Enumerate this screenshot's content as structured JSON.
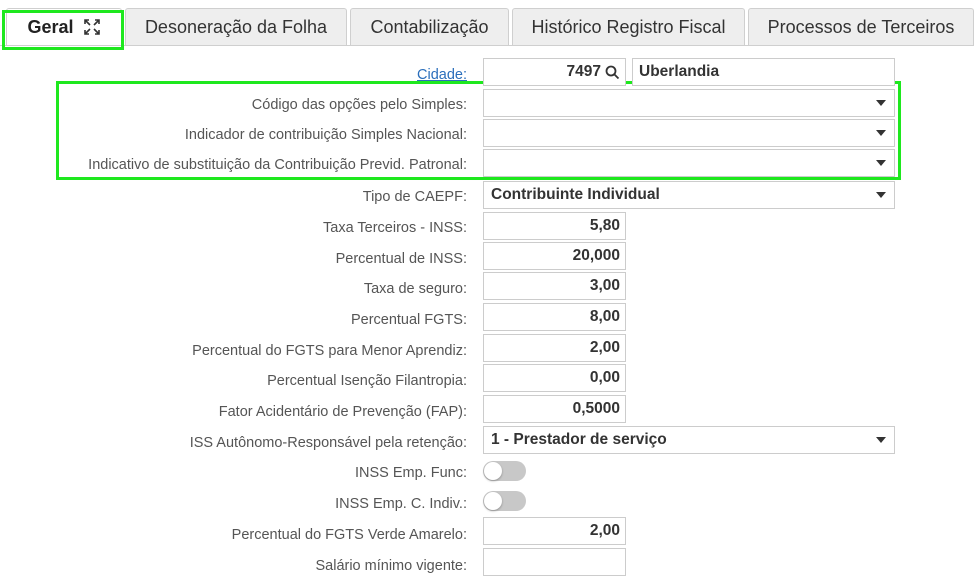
{
  "tabs": [
    {
      "label": "Geral",
      "active": true,
      "icon": "expand-icon"
    },
    {
      "label": "Desoneração da Folha"
    },
    {
      "label": "Contabilização"
    },
    {
      "label": "Histórico Registro Fiscal"
    },
    {
      "label": "Processos de Terceiros"
    }
  ],
  "colors": {
    "highlight": "#1ee81e",
    "link": "#2a6ebb"
  },
  "form": {
    "cidade": {
      "label": "Cidade:",
      "code": "7497",
      "icon": "search-icon",
      "name": "Uberlandia"
    },
    "codigo_opcoes_simples": {
      "label": "Código das opções pelo Simples:",
      "value": ""
    },
    "indicador_simples": {
      "label": "Indicador de contribuição Simples Nacional:",
      "value": ""
    },
    "indicativo_substituicao": {
      "label": "Indicativo de substituição da Contribuição Previd. Patronal:",
      "value": ""
    },
    "tipo_caepf": {
      "label": "Tipo de CAEPF:",
      "value": "Contribuinte Individual"
    },
    "taxa_terceiros": {
      "label": "Taxa Terceiros - INSS:",
      "value": "5,80"
    },
    "percentual_inss": {
      "label": "Percentual de INSS:",
      "value": "20,000"
    },
    "taxa_seguro": {
      "label": "Taxa de seguro:",
      "value": "3,00"
    },
    "percentual_fgts": {
      "label": "Percentual FGTS:",
      "value": "8,00"
    },
    "fgts_menor_aprendiz": {
      "label": "Percentual do FGTS para Menor Aprendiz:",
      "value": "2,00"
    },
    "isencao_filantropia": {
      "label": "Percentual Isenção Filantropia:",
      "value": "0,00"
    },
    "fap": {
      "label": "Fator Acidentário de Prevenção (FAP):",
      "value": "0,5000"
    },
    "iss_autonomo": {
      "label": "ISS Autônomo-Responsável pela retenção:",
      "value": "1 - Prestador de serviço"
    },
    "inss_emp_func": {
      "label": "INSS Emp. Func:",
      "on": false
    },
    "inss_emp_c_indiv": {
      "label": "INSS Emp. C. Indiv.:",
      "on": false
    },
    "fgts_verde_amarelo": {
      "label": "Percentual do FGTS Verde Amarelo:",
      "value": "2,00"
    },
    "salario_minimo": {
      "label": "Salário mínimo vigente:",
      "value": ""
    }
  }
}
